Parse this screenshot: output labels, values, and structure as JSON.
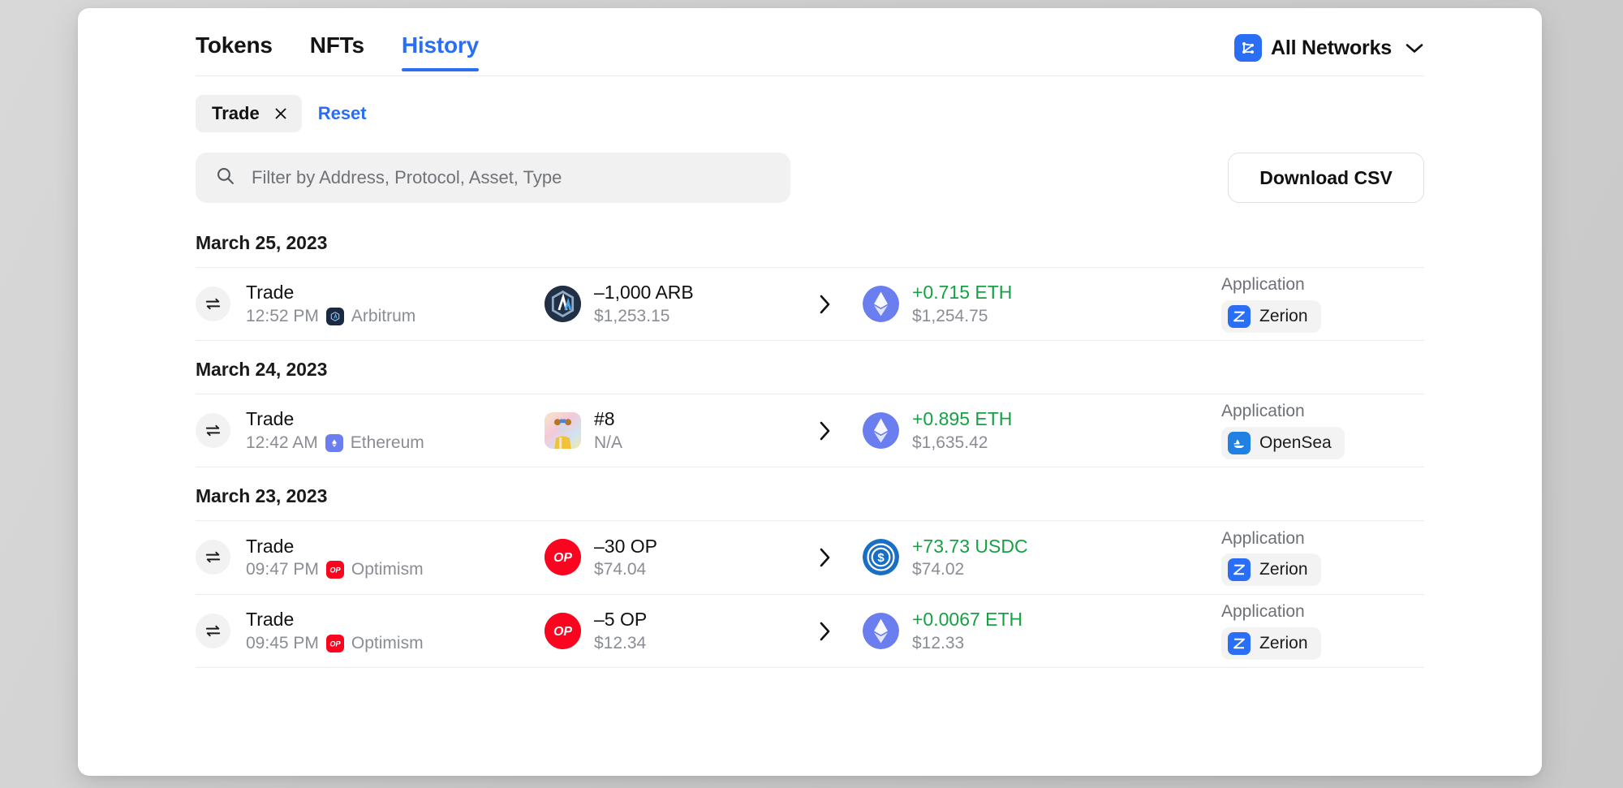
{
  "tabs": [
    {
      "label": "Tokens",
      "active": false
    },
    {
      "label": "NFTs",
      "active": false
    },
    {
      "label": "History",
      "active": true
    }
  ],
  "network_selector": {
    "label": "All Networks",
    "icon": "network-graph-icon",
    "chevron": "chevron-down-icon"
  },
  "filters": {
    "chip_label": "Trade",
    "chip_remove_icon": "close-icon",
    "reset_label": "Reset"
  },
  "search": {
    "placeholder": "Filter by Address, Protocol, Asset, Type",
    "value": "",
    "icon": "search-icon"
  },
  "download_button": {
    "label": "Download CSV"
  },
  "colors": {
    "accent": "#2b6ef6",
    "positive": "#15a144",
    "muted": "#8a8d94",
    "chip_bg": "#f0f0f0"
  },
  "app_column_label": "Application",
  "groups": [
    {
      "date": "March 25, 2023",
      "rows": [
        {
          "type": "Trade",
          "type_icon": "swap-arrows-icon",
          "time": "12:52 PM",
          "chain": "Arbitrum",
          "chain_icon": "arbitrum-icon",
          "sent_amount": "–1,000 ARB",
          "sent_value": "$1,253.15",
          "sent_icon": "arbitrum-token-icon",
          "arrow_icon": "chevron-right-icon",
          "recv_amount": "+0.715 ETH",
          "recv_value": "$1,254.75",
          "recv_icon": "ethereum-token-icon",
          "app_label": "Application",
          "app_name": "Zerion",
          "app_icon": "zerion-icon"
        }
      ]
    },
    {
      "date": "March 24, 2023",
      "rows": [
        {
          "type": "Trade",
          "type_icon": "swap-arrows-icon",
          "time": "12:42 AM",
          "chain": "Ethereum",
          "chain_icon": "ethereum-icon",
          "sent_amount": "#8",
          "sent_value": "N/A",
          "sent_icon": "nft-thumbnail",
          "arrow_icon": "chevron-right-icon",
          "recv_amount": "+0.895 ETH",
          "recv_value": "$1,635.42",
          "recv_icon": "ethereum-token-icon",
          "app_label": "Application",
          "app_name": "OpenSea",
          "app_icon": "opensea-icon"
        }
      ]
    },
    {
      "date": "March 23, 2023",
      "rows": [
        {
          "type": "Trade",
          "type_icon": "swap-arrows-icon",
          "time": "09:47 PM",
          "chain": "Optimism",
          "chain_icon": "optimism-icon",
          "sent_amount": "–30 OP",
          "sent_value": "$74.04",
          "sent_icon": "optimism-token-icon",
          "arrow_icon": "chevron-right-icon",
          "recv_amount": "+73.73 USDC",
          "recv_value": "$74.02",
          "recv_icon": "usdc-token-icon",
          "app_label": "Application",
          "app_name": "Zerion",
          "app_icon": "zerion-icon"
        },
        {
          "type": "Trade",
          "type_icon": "swap-arrows-icon",
          "time": "09:45 PM",
          "chain": "Optimism",
          "chain_icon": "optimism-icon",
          "sent_amount": "–5 OP",
          "sent_value": "$12.34",
          "sent_icon": "optimism-token-icon",
          "arrow_icon": "chevron-right-icon",
          "recv_amount": "+0.0067 ETH",
          "recv_value": "$12.33",
          "recv_icon": "ethereum-token-icon",
          "app_label": "Application",
          "app_name": "Zerion",
          "app_icon": "zerion-icon"
        }
      ]
    }
  ]
}
